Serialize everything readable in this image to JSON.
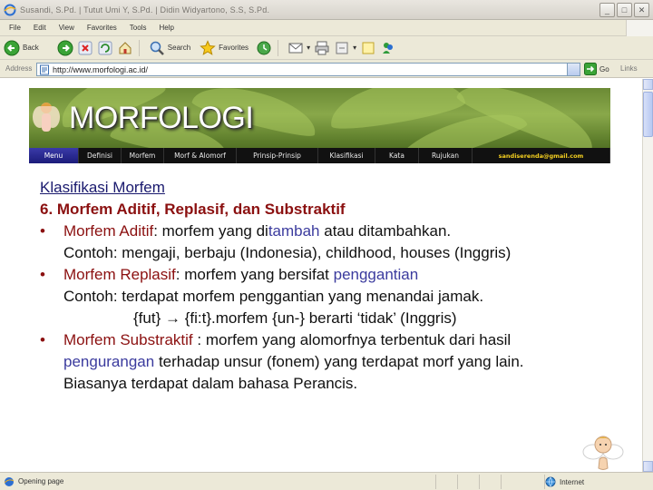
{
  "window": {
    "title": "Susandi, S.Pd. | Tutut Umi Y, S.Pd. | Didin Widyartono, S.S, S.Pd."
  },
  "menu": [
    "File",
    "Edit",
    "View",
    "Favorites",
    "Tools",
    "Help"
  ],
  "toolbar": {
    "back_label": "Back",
    "search_label": "Search",
    "favorites_label": "Favorites"
  },
  "address": {
    "label": "Address",
    "url": "http://www.morfologi.ac.id/",
    "go_label": "Go",
    "links_label": "Links"
  },
  "site": {
    "title": "MORFOLOGI",
    "nav": [
      "Menu",
      "Definisi",
      "Morfem",
      "Morf & Alomorf",
      "Prinsip-Prinsip",
      "Klasifikasi",
      "Kata",
      "Rujukan",
      "sandiserenda@gmail.com"
    ],
    "active_nav": "Menu"
  },
  "slide": {
    "heading": "Klasifikasi Morfem",
    "subheading": "6. Morfem Aditif, Replasif, dan Substraktif",
    "bullet_char": "•",
    "b1_term": "Morfem Aditif",
    "b1_colon": ":  morfem yang di",
    "b1_hl": "tambah",
    "b1_rest": " atau ditambahkan.",
    "b1_example": "Contoh: mengaji, berbaju (Indonesia), childhood, houses (Inggris)",
    "b2_term": "Morfem Replasif",
    "b2_rest": ": morfem yang bersifat ",
    "b2_hl": "penggantian",
    "b2_example": "Contoh: terdapat morfem penggantian yang menandai jamak.",
    "b2_formula": "{fut} → {fi:t}.morfem {un-} berarti ‘tidak’ (Inggris)",
    "b3_term": "Morfem Substraktif",
    "b3_rest": " : morfem yang alomorfnya terbentuk dari hasil",
    "b3_hl": "pengurangan",
    "b3_cont": " terhadap unsur (fonem) yang terdapat morf yang lain.",
    "b3_end": "Biasanya terdapat dalam bahasa Perancis."
  },
  "status": {
    "text": "Opening page",
    "zone": "Internet"
  }
}
